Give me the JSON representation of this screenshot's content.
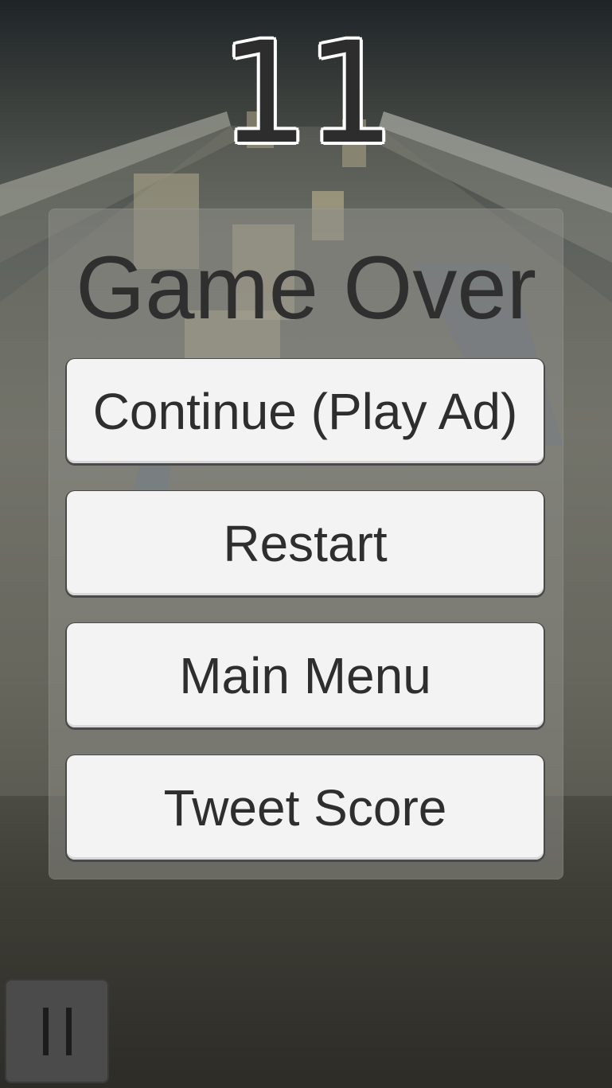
{
  "hud": {
    "score": "11",
    "pause_icon": "pause-icon"
  },
  "game_over": {
    "title": "Game Over",
    "buttons": [
      {
        "label": "Continue (Play Ad)"
      },
      {
        "label": "Restart"
      },
      {
        "label": "Main Menu"
      },
      {
        "label": "Tweet Score"
      }
    ]
  },
  "colors": {
    "panel": "#8c8c87",
    "button": "#f3f3f3",
    "text": "#2e2e2e"
  }
}
